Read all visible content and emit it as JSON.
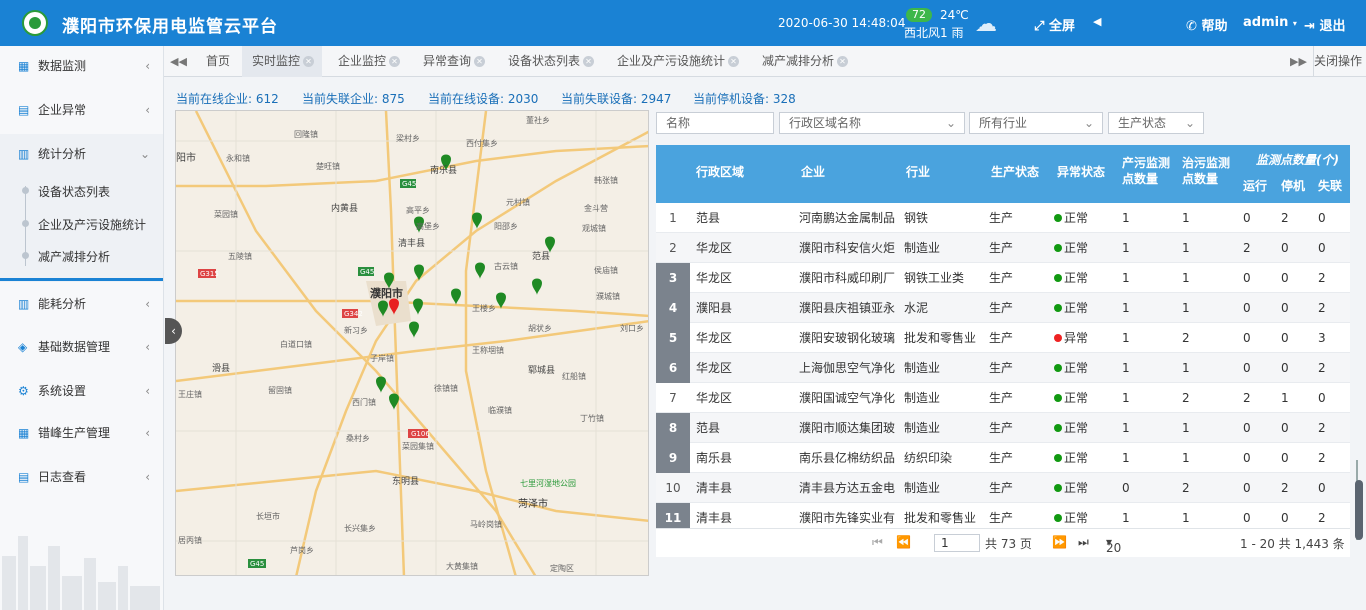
{
  "app": {
    "title": "濮阳市环保用电监管云平台",
    "datetime": "2020-06-30  14:48:04",
    "aqi": "72",
    "temperature": "24℃",
    "weather": "西北风1 雨",
    "fullscreen": "全屏",
    "help": "帮助",
    "user": "admin",
    "logout": "退出"
  },
  "sidebar": {
    "items": [
      {
        "label": "数据监测",
        "icon": "calendar-icon"
      },
      {
        "label": "企业异常",
        "icon": "document-icon"
      },
      {
        "label": "统计分析",
        "icon": "bar-chart-icon"
      },
      {
        "label": "能耗分析",
        "icon": "bar-chart-icon"
      },
      {
        "label": "基础数据管理",
        "icon": "layers-icon"
      },
      {
        "label": "系统设置",
        "icon": "gear-icon"
      },
      {
        "label": "错峰生产管理",
        "icon": "calendar-icon"
      },
      {
        "label": "日志查看",
        "icon": "document-icon"
      }
    ],
    "sub": [
      "设备状态列表",
      "企业及产污设施统计",
      "减产减排分析"
    ]
  },
  "tabs": [
    "首页",
    "实时监控",
    "企业监控",
    "异常查询",
    "设备状态列表",
    "企业及产污设施统计",
    "减产减排分析"
  ],
  "tabs_close_all": "关闭操作",
  "stats": [
    "当前在线企业: 612",
    "当前失联企业: 875",
    "当前在线设备: 2030",
    "当前失联设备: 2947",
    "当前停机设备: 328"
  ],
  "filters": {
    "name_placeholder": "名称",
    "region_placeholder": "行政区域名称",
    "industry": "所有行业",
    "status": "生产状态"
  },
  "table": {
    "headers": [
      "行政区域",
      "企业",
      "行业",
      "生产状态",
      "异常状态",
      "产污监测点数量",
      "治污监测点数量",
      "监测点数量(个)",
      "运行",
      "停机",
      "失联"
    ],
    "rows": [
      [
        "1",
        "范县",
        "河南鹏达金属制品有",
        "钢铁",
        "生产",
        "正常",
        "1",
        "1",
        "0",
        "2",
        "0"
      ],
      [
        "2",
        "华龙区",
        "濮阳市科安信火炬",
        "制造业",
        "生产",
        "正常",
        "1",
        "1",
        "2",
        "0",
        "0"
      ],
      [
        "3",
        "华龙区",
        "濮阳市科威印刷厂",
        "钢铁工业类",
        "生产",
        "正常",
        "1",
        "1",
        "0",
        "0",
        "2"
      ],
      [
        "4",
        "濮阳县",
        "濮阳县庆祖镇亚永",
        "水泥",
        "生产",
        "正常",
        "1",
        "1",
        "0",
        "0",
        "2"
      ],
      [
        "5",
        "华龙区",
        "濮阳安玻钢化玻璃",
        "批发和零售业",
        "生产",
        "异常",
        "1",
        "2",
        "0",
        "0",
        "3"
      ],
      [
        "6",
        "华龙区",
        "上海伽思空气净化",
        "制造业",
        "生产",
        "正常",
        "1",
        "1",
        "0",
        "0",
        "2"
      ],
      [
        "7",
        "华龙区",
        "濮阳国诚空气净化",
        "制造业",
        "生产",
        "正常",
        "1",
        "2",
        "2",
        "1",
        "0"
      ],
      [
        "8",
        "范县",
        "濮阳市顺达集团玻",
        "制造业",
        "生产",
        "正常",
        "1",
        "1",
        "0",
        "0",
        "2"
      ],
      [
        "9",
        "南乐县",
        "南乐县亿棉纺织品",
        "纺织印染",
        "生产",
        "正常",
        "1",
        "1",
        "0",
        "0",
        "2"
      ],
      [
        "10",
        "清丰县",
        "清丰县方达五金电",
        "制造业",
        "生产",
        "正常",
        "0",
        "2",
        "0",
        "2",
        "0"
      ],
      [
        "11",
        "清丰县",
        "濮阳市先锋实业有",
        "批发和零售业",
        "生产",
        "正常",
        "1",
        "1",
        "0",
        "0",
        "2"
      ]
    ]
  },
  "pager": {
    "page": "1",
    "total_pages": "共 73 页",
    "page_size": "20",
    "summary": "1 - 20  共 1,443 条"
  },
  "map_labels": [
    "回隆镇",
    "梁村乡",
    "西付集乡",
    "董社乡",
    "阳市",
    "永和镇",
    "楚旺镇",
    "南乐县",
    "韩张镇",
    "高平乡",
    "元村镇",
    "内黄县",
    "金斗营",
    "菜园镇",
    "高堡乡",
    "阳邵乡",
    "清丰县",
    "观城镇",
    "五陵镇",
    "古云镇",
    "范县",
    "侯庙镇",
    "濮阳市",
    "王楼乡",
    "濮城镇",
    "白道口镇",
    "新习乡",
    "胡状乡",
    "子岸镇",
    "王称堌镇",
    "刘口乡",
    "滑县",
    "郓城县",
    "红船镇",
    "王庄镇",
    "留固镇",
    "徐镇镇",
    "西门镇",
    "临濮镇",
    "丁竹镇",
    "桑村乡",
    "菜园集镇",
    "长垣市",
    "东明县",
    "七里河湿地公园",
    "菏泽市",
    "长兴集乡",
    "马岭岗镇",
    "居丙镇",
    "芦岗乡",
    "大黄集镇",
    "定陶区"
  ],
  "colors": {
    "primary": "#1a82d4",
    "header_grid": "#4aa3de",
    "ok": "#119911",
    "err": "#ee2222",
    "marker": "#1f8a24"
  }
}
